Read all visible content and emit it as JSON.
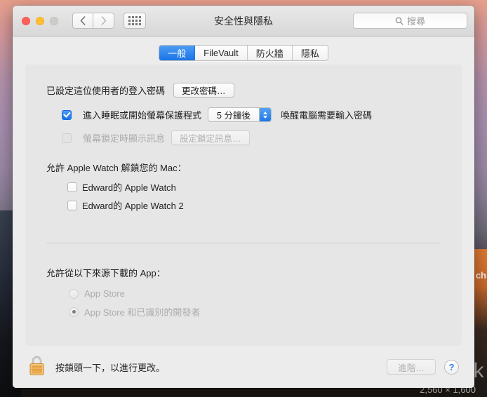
{
  "window": {
    "title": "安全性與隱私",
    "traffic_lights": [
      "close",
      "minimize",
      "zoom"
    ]
  },
  "toolbar": {
    "back_icon": "chevron-left-icon",
    "forward_icon": "chevron-right-icon",
    "show_all_icon": "grid-dots-icon",
    "search": {
      "icon": "search-icon",
      "placeholder": "搜尋",
      "value": ""
    }
  },
  "tabs": [
    {
      "label": "一般",
      "active": true
    },
    {
      "label": "FileVault",
      "active": false
    },
    {
      "label": "防火牆",
      "active": false
    },
    {
      "label": "隱私",
      "active": false
    }
  ],
  "main": {
    "login_password": {
      "label": "已設定這位使用者的登入密碼",
      "change_button": "更改密碼…"
    },
    "require_password": {
      "checked": true,
      "enabled": true,
      "label_before": "進入睡眠或開始螢幕保護程式",
      "delay_value": "5 分鐘後",
      "label_after": "喚醒電腦需要輸入密碼",
      "stepper_icon": "stepper-up-down-icon"
    },
    "lock_message": {
      "checked": false,
      "enabled": false,
      "label": "螢幕鎖定時顯示訊息",
      "set_button": "設定鎖定訊息…"
    },
    "apple_watch": {
      "title": "允許 Apple Watch 解鎖您的 Mac：",
      "devices": [
        {
          "label": "Edward的 Apple Watch",
          "checked": false
        },
        {
          "label": "Edward的 Apple Watch 2",
          "checked": false
        }
      ]
    },
    "app_download": {
      "title": "允許從以下來源下載的 App：",
      "enabled": false,
      "options": [
        {
          "label": "App Store",
          "selected": false
        },
        {
          "label": "App Store 和已識別的開發者",
          "selected": true
        }
      ]
    }
  },
  "bottom_bar": {
    "lock_icon": "padlock-locked-icon",
    "note": "按鎖頭一下，以進行更改。",
    "advanced_button": "進階…",
    "advanced_enabled": false,
    "help_button": "?"
  },
  "desktop": {
    "watermark": "unwire.hk",
    "resolution_label": "2,560 × 1,600",
    "text_fragment": "ch"
  },
  "colors": {
    "accent_blue": "#1a74e8",
    "window_bg": "#ececec",
    "panel_bg": "#e6e6e6",
    "help_blue": "#2b7ee8"
  }
}
